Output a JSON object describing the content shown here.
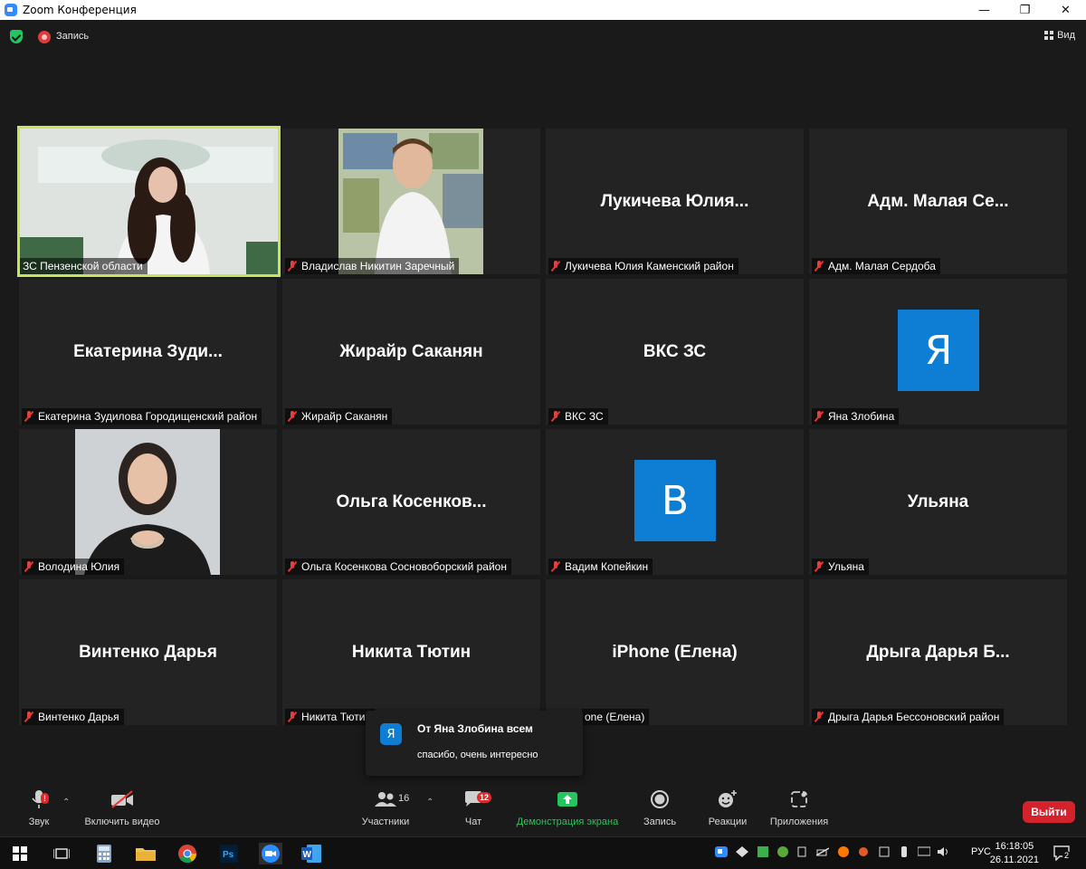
{
  "window": {
    "title": "Zoom Конференция",
    "minimize": "—",
    "maximize": "❐",
    "close": "✕"
  },
  "topbar": {
    "record_label": "Запись",
    "view_label": "Вид"
  },
  "tiles": [
    {
      "id": "t1",
      "label": "ЗС Пензенской области",
      "muted": false,
      "center": ""
    },
    {
      "id": "t2",
      "label": "Владислав Никитин Заречный",
      "muted": true,
      "center": ""
    },
    {
      "id": "t3",
      "label": "Лукичева Юлия Каменский район",
      "muted": true,
      "center": "Лукичева  Юлия..."
    },
    {
      "id": "t4",
      "label": "Адм. Малая Сердоба",
      "muted": true,
      "center": "Адм. Малая Се..."
    },
    {
      "id": "t5",
      "label": "Екатерина Зудилова Городищенский район",
      "muted": true,
      "center": "Екатерина  Зуди..."
    },
    {
      "id": "t6",
      "label": "Жирайр Саканян",
      "muted": true,
      "center": "Жирайр Саканян"
    },
    {
      "id": "t7",
      "label": "ВКС ЗС",
      "muted": true,
      "center": "ВКС ЗС"
    },
    {
      "id": "t8",
      "label": "Яна Злобина",
      "muted": true,
      "center": "",
      "avatar": "Я"
    },
    {
      "id": "t9",
      "label": "Володина Юлия",
      "muted": true,
      "center": ""
    },
    {
      "id": "t10",
      "label": "Ольга Косенкова Сосновоборский район",
      "muted": true,
      "center": "Ольга  Косенков..."
    },
    {
      "id": "t11",
      "label": "Вадим Копейкин",
      "muted": true,
      "center": "",
      "avatar": "В"
    },
    {
      "id": "t12",
      "label": "Ульяна",
      "muted": true,
      "center": "Ульяна"
    },
    {
      "id": "t13",
      "label": "Винтенко Дарья",
      "muted": true,
      "center": "Винтенко Дарья"
    },
    {
      "id": "t14",
      "label": "Никита Тютин",
      "muted": true,
      "center": "Никита Тютин"
    },
    {
      "id": "t15",
      "label": "one (Елена)",
      "muted": false,
      "center": "iPhone (Елена)"
    },
    {
      "id": "t16",
      "label": "Дрыга Дарья Бессоновский район",
      "muted": true,
      "center": "Дрыга Дарья Б..."
    }
  ],
  "chat_popup": {
    "avatar": "Я",
    "from": "От Яна Злобина всем",
    "message": "спасибо, очень интересно"
  },
  "controls": {
    "audio_label": "Звук",
    "video_label": "Включить видео",
    "participants_label": "Участники",
    "participants_count": "16",
    "chat_label": "Чат",
    "chat_badge": "12",
    "share_label": "Демонстрация экрана",
    "record_label": "Запись",
    "reactions_label": "Реакции",
    "apps_label": "Приложения",
    "leave_label": "Выйти",
    "audio_alert": "!"
  },
  "taskbar": {
    "lang": "РУС",
    "time": "16:18:05",
    "date": "26.11.2021",
    "notif_count": "2",
    "ps_label": "Ps",
    "word_label": "W"
  },
  "colors": {
    "active_speaker": "#c6e55c",
    "avatar_blue": "#0d7ed4",
    "leave_red": "#d3222c",
    "share_green": "#23c55e"
  }
}
